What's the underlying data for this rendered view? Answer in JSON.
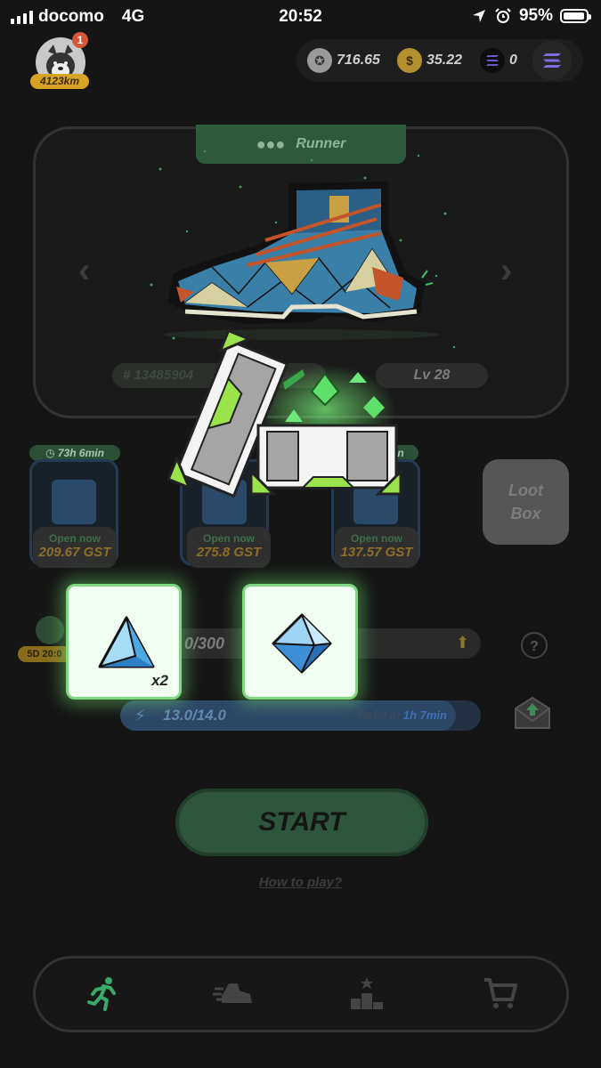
{
  "status_bar": {
    "carrier": "docomo",
    "network": "4G",
    "time": "20:52",
    "battery": "95%",
    "battery_level": 0.95
  },
  "profile": {
    "notification_count": "1",
    "distance": "4123km"
  },
  "wallet": {
    "gmt": "716.65",
    "gst": "35.22",
    "sol": "0"
  },
  "sneaker": {
    "type": "Runner",
    "id": "# 13485904",
    "level": "Lv 28"
  },
  "mystery_boxes": [
    {
      "timer": "73h 6min",
      "action": "Open now",
      "price": "209.67 GST"
    },
    {
      "timer": "",
      "action": "Open now",
      "price": "275.8 GST"
    },
    {
      "timer": "n",
      "action": "Open now",
      "price": "137.57 GST"
    }
  ],
  "loot_box": {
    "label_line1": "Loot",
    "label_line2": "Box"
  },
  "durability": {
    "badge": "5D 20:0",
    "value": "0/300"
  },
  "energy": {
    "value": "13.0/14.0",
    "level": 0.93,
    "refill_label": "Refill in",
    "refill_time": "1h 7min"
  },
  "start_button": "START",
  "how_to_play": "How to play?",
  "rewards": [
    {
      "icon": "pyramid-gem-icon",
      "quantity": "x2"
    },
    {
      "icon": "octahedron-gem-icon",
      "quantity": ""
    }
  ],
  "colors": {
    "accent_green": "#7fd77f",
    "gst_gold": "#d9a423",
    "energy_blue": "#3e71b4"
  }
}
